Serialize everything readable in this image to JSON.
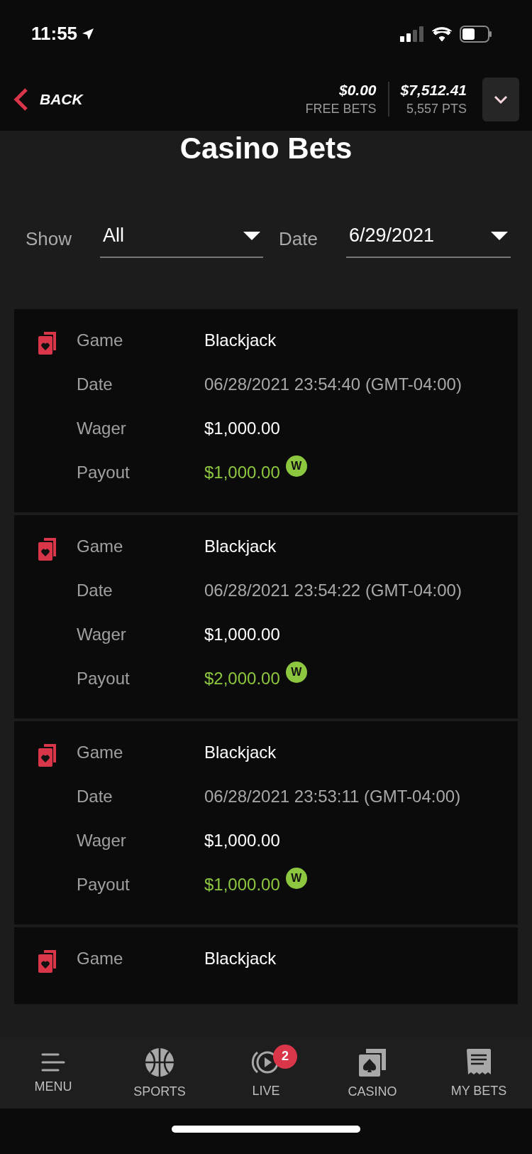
{
  "status_bar": {
    "time": "11:55"
  },
  "header": {
    "back": "BACK",
    "free_bets": {
      "amount": "$0.00",
      "label": "FREE BETS"
    },
    "balance": {
      "amount": "$7,512.41",
      "label": "5,557 PTS"
    }
  },
  "title": "Casino Bets",
  "filters": [
    {
      "label": "Show",
      "value": "All"
    },
    {
      "label": "Date",
      "value": "6/29/2021"
    }
  ],
  "bets": [
    {
      "rows": [
        {
          "label": "Game",
          "value": "Blackjack",
          "kind": "plain"
        },
        {
          "label": "Date",
          "value": "06/28/2021 23:54:40 (GMT-04:00)",
          "kind": "muted"
        },
        {
          "label": "Wager",
          "value": "$1,000.00",
          "kind": "plain"
        },
        {
          "label": "Payout",
          "value": "$1,000.00",
          "kind": "win",
          "badge": "W"
        }
      ]
    },
    {
      "rows": [
        {
          "label": "Game",
          "value": "Blackjack",
          "kind": "plain"
        },
        {
          "label": "Date",
          "value": "06/28/2021 23:54:22 (GMT-04:00)",
          "kind": "muted"
        },
        {
          "label": "Wager",
          "value": "$1,000.00",
          "kind": "plain"
        },
        {
          "label": "Payout",
          "value": "$2,000.00",
          "kind": "win",
          "badge": "W"
        }
      ]
    },
    {
      "rows": [
        {
          "label": "Game",
          "value": "Blackjack",
          "kind": "plain"
        },
        {
          "label": "Date",
          "value": "06/28/2021 23:53:11 (GMT-04:00)",
          "kind": "muted"
        },
        {
          "label": "Wager",
          "value": "$1,000.00",
          "kind": "plain"
        },
        {
          "label": "Payout",
          "value": "$1,000.00",
          "kind": "win",
          "badge": "W"
        }
      ]
    },
    {
      "rows": [
        {
          "label": "Game",
          "value": "Blackjack",
          "kind": "plain"
        }
      ]
    }
  ],
  "tab_bar": [
    {
      "label": "MENU",
      "kind": "menu"
    },
    {
      "label": "SPORTS",
      "kind": "sports"
    },
    {
      "label": "LIVE",
      "kind": "live",
      "badge": "2"
    },
    {
      "label": "CASINO",
      "kind": "casino"
    },
    {
      "label": "MY BETS",
      "kind": "mybets"
    }
  ]
}
